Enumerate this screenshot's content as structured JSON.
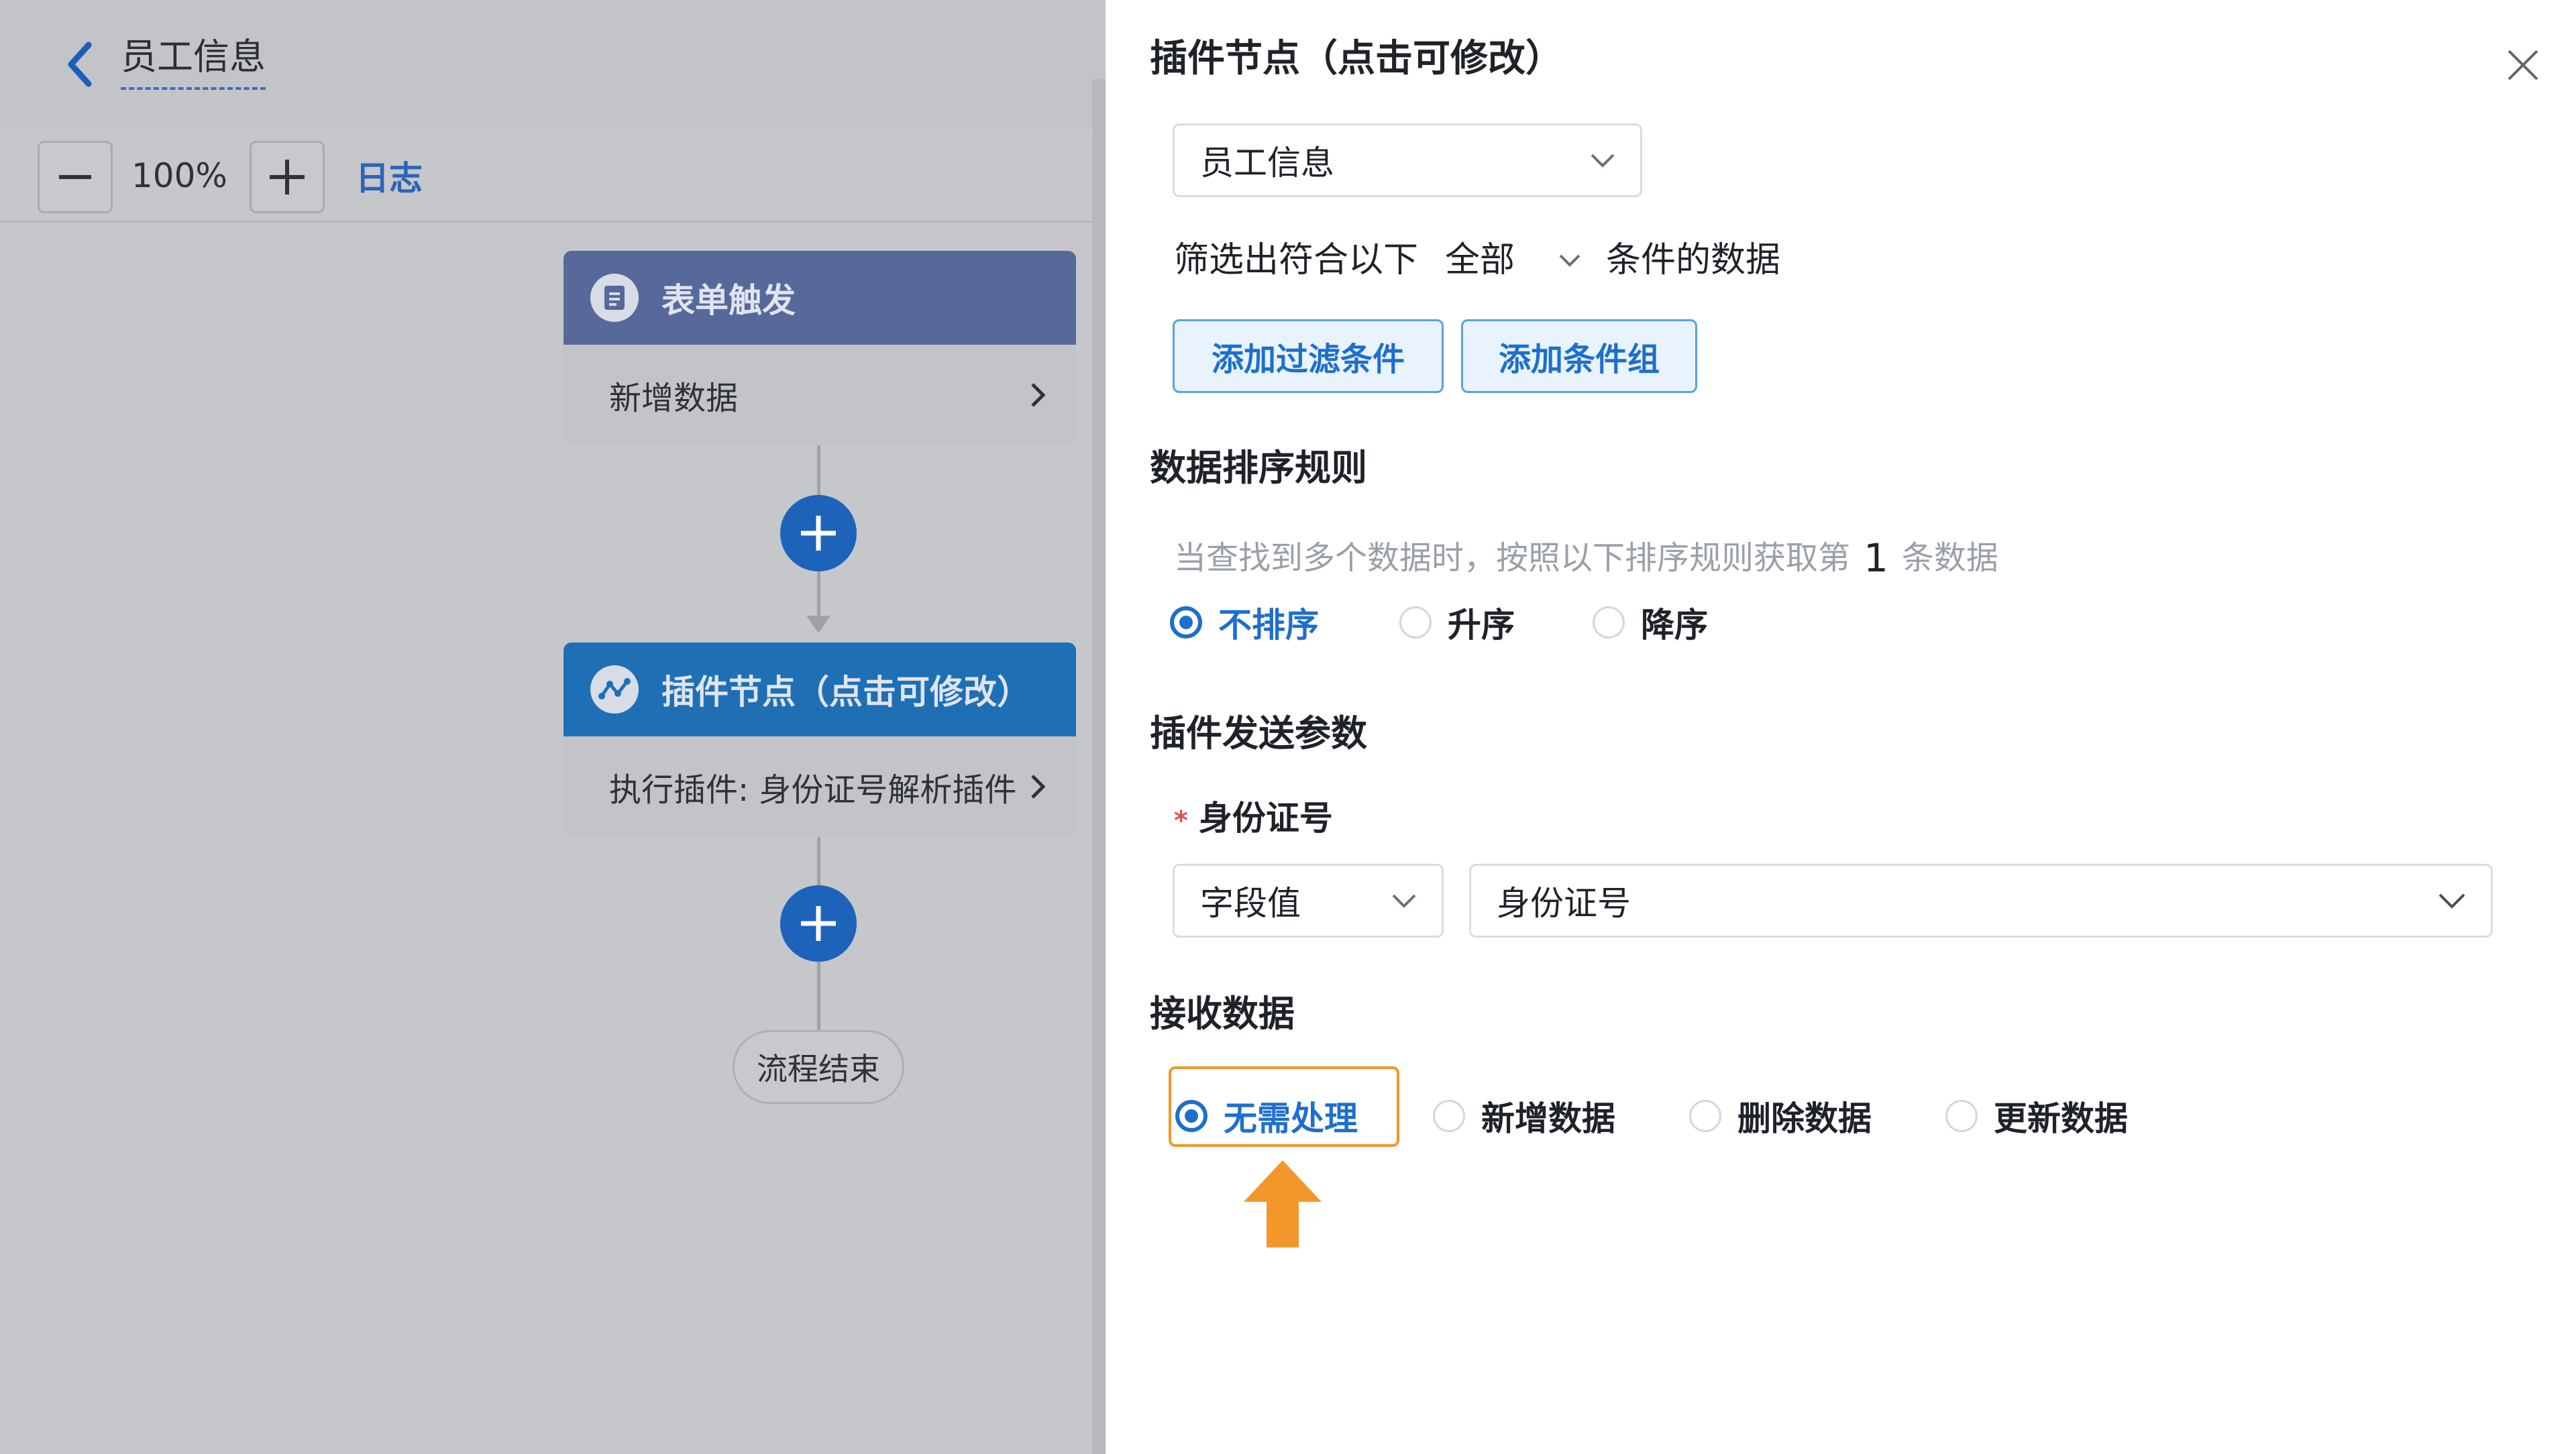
{
  "canvas": {
    "doc_title": "员工信息",
    "zoom": "100%",
    "log_label": "日志",
    "node1": {
      "title": "表单触发",
      "body": "新增数据"
    },
    "node2": {
      "title": "插件节点（点击可修改）",
      "body": "执行插件: 身份证号解析插件"
    },
    "end_label": "流程结束"
  },
  "drawer": {
    "title": "插件节点（点击可修改）",
    "form_select": "员工信息",
    "filter": {
      "prefix": "筛选出符合以下",
      "mode": "全部",
      "suffix": "条件的数据"
    },
    "buttons": {
      "add_filter": "添加过滤条件",
      "add_group": "添加条件组"
    },
    "sort": {
      "section": "数据排序规则",
      "hint_before": "当查找到多个数据时，按照以下排序规则获取第",
      "hint_count": "1",
      "hint_after": "条数据",
      "options": [
        "不排序",
        "升序",
        "降序"
      ],
      "selected": "不排序"
    },
    "params": {
      "section": "插件发送参数",
      "required_mark": "*",
      "field_label": "身份证号",
      "value_type": "字段值",
      "value_field": "身份证号"
    },
    "receive": {
      "section": "接收数据",
      "options": [
        "无需处理",
        "新增数据",
        "删除数据",
        "更新数据"
      ],
      "selected": "无需处理"
    }
  },
  "colors": {
    "accent": "#1d6fce",
    "highlight": "#f3972b",
    "node_trigger": "#56699a",
    "node_plugin": "#1f6fb5"
  }
}
